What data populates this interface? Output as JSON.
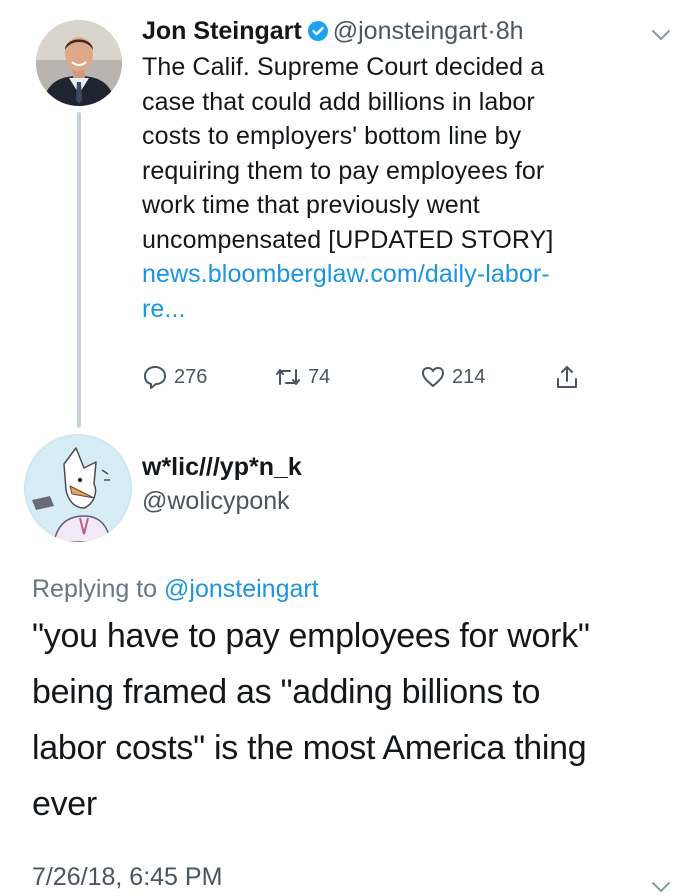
{
  "tweet": {
    "author_name": "Jon Steingart",
    "handle": "@jonsteingart",
    "separator": "·",
    "time": "8h",
    "text_lines": [
      "The Calif. Supreme Court decided a",
      "case that could add billions in labor",
      "costs to employers' bottom line by",
      "requiring them to pay employees for",
      "work time that previously went",
      "uncompensated [UPDATED STORY]"
    ],
    "link_lines": [
      "news.bloomberglaw.com/daily-labor-",
      "re..."
    ],
    "actions": {
      "replies": "276",
      "retweets": "74",
      "likes": "214"
    }
  },
  "reply": {
    "author_name": "w*lic///yp*n_k",
    "handle": "@wolicyponk",
    "replying_prefix": "Replying to",
    "replying_handle": "@jonsteingart",
    "text_lines": [
      "\"you have to pay employees for work\"",
      "being framed as \"adding billions to",
      "labor costs\" is the most America thing",
      "ever"
    ],
    "timestamp": "7/26/18, 6:45 PM"
  },
  "icons": {
    "verified": "verified-badge-icon",
    "reply": "reply-icon",
    "retweet": "retweet-icon",
    "like": "heart-icon",
    "share": "share-icon",
    "menu": "chevron-down-icon"
  },
  "colors": {
    "link": "#1b95e0",
    "verified": "#1da1f2",
    "muted": "#657786",
    "text": "#14171a"
  }
}
